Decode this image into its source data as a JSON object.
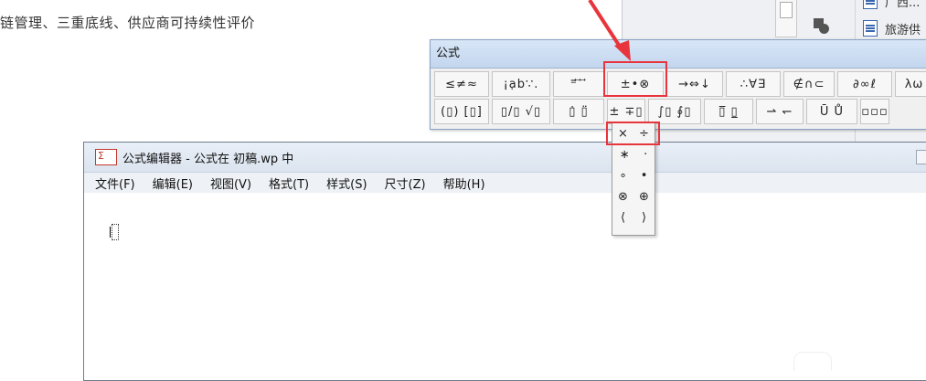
{
  "document": {
    "text": "链管理、三重底线、供应商可持续性评价"
  },
  "side_panel": {
    "items": [
      {
        "label": "广西..."
      },
      {
        "label": "旅游供"
      }
    ]
  },
  "palette": {
    "title": "公式",
    "row1": [
      {
        "label": "≤≠≈",
        "w": 58
      },
      {
        "label": "¡ạb∵.",
        "w": 62
      },
      {
        "label": "⁼⃗ ⃗ ⃗",
        "w": 54
      },
      {
        "label": "±•⊗",
        "w": 60
      },
      {
        "label": "→⇔↓",
        "w": 60
      },
      {
        "label": "∴∀∃",
        "w": 58
      },
      {
        "label": "∉∩⊂",
        "w": 54
      },
      {
        "label": "∂∞ℓ",
        "w": 58
      },
      {
        "label": "λω",
        "w": 40
      }
    ],
    "row2": [
      {
        "label": "(▯) [▯]",
        "w": 58
      },
      {
        "label": "▯/▯ √▯",
        "w": 62
      },
      {
        "label": "▯̇ ▯̈",
        "w": 54
      },
      {
        "label": "± ∓▯",
        "w": 40
      },
      {
        "label": "∫▯ ∮▯",
        "w": 56
      },
      {
        "label": "▯̅ ▯̲",
        "w": 52
      },
      {
        "label": "⇀ ↽",
        "w": 50
      },
      {
        "label": "Ū Ů",
        "w": 54
      },
      {
        "label": "▫▫▫",
        "w": 30
      }
    ]
  },
  "dropdown": {
    "items": [
      [
        "×",
        "÷"
      ],
      [
        "∗",
        "·"
      ],
      [
        "∘",
        "•"
      ],
      [
        "⊗",
        "⊕"
      ],
      [
        "⟨",
        "⟩"
      ]
    ]
  },
  "editor": {
    "title": "公式编辑器 - 公式在 初稿.wp 中",
    "app_icon": "Σ",
    "menu": [
      "文件(F)",
      "编辑(E)",
      "视图(V)",
      "格式(T)",
      "样式(S)",
      "尺寸(Z)",
      "帮助(H)"
    ]
  },
  "colors": {
    "accent_red": "#e8343c",
    "palette_bg": "#f0f0f0",
    "title_blue": "#c3d6ee"
  }
}
